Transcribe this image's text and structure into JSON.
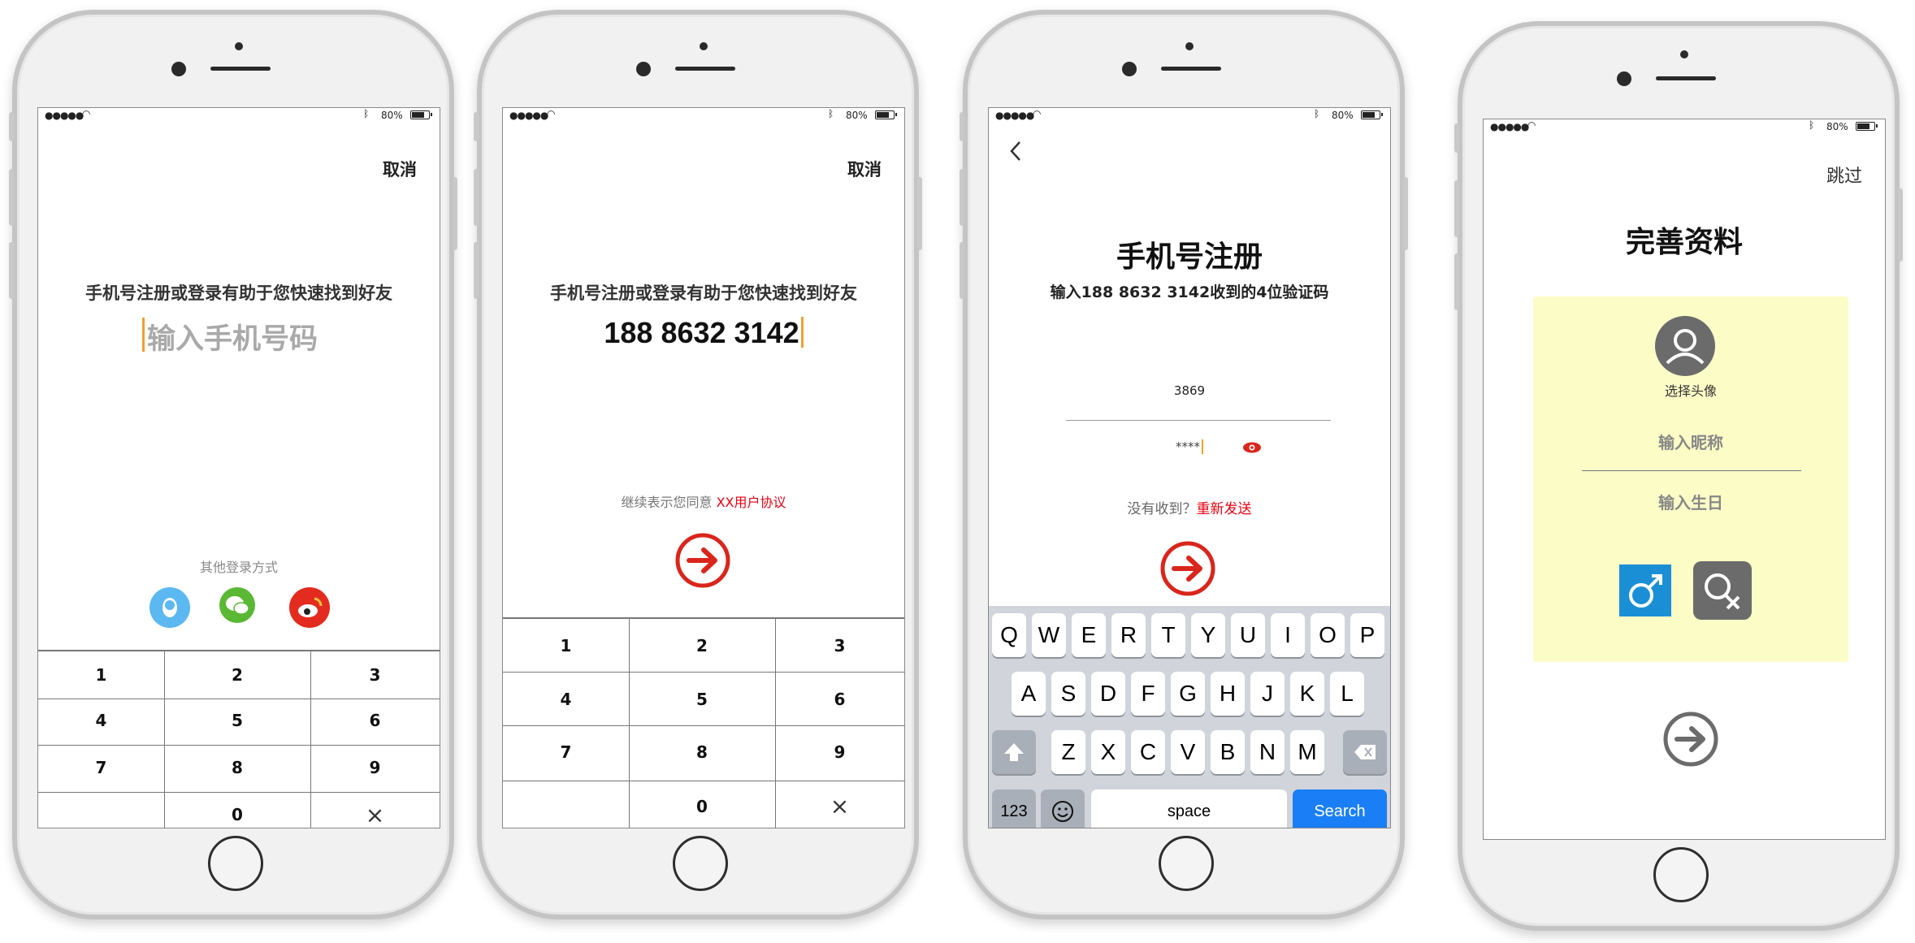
{
  "status": {
    "battery": "80%"
  },
  "screen1": {
    "cancel": "取消",
    "prompt": "手机号注册或登录有助于您快速找到好友",
    "phone_placeholder": "输入手机号码",
    "other_login": "其他登录方式",
    "social_icons": [
      "qq-icon",
      "wechat-icon",
      "weibo-icon"
    ],
    "keys": [
      "1",
      "2",
      "3",
      "4",
      "5",
      "6",
      "7",
      "8",
      "9",
      "",
      "0",
      "×"
    ]
  },
  "screen2": {
    "cancel": "取消",
    "prompt": "手机号注册或登录有助于您快速找到好友",
    "phone_value": "188 8632 3142",
    "agree_text": "继续表示您同意",
    "agreement_link": "XX用户协议",
    "keys": [
      "1",
      "2",
      "3",
      "4",
      "5",
      "6",
      "7",
      "8",
      "9",
      "",
      "0",
      "×"
    ]
  },
  "screen3": {
    "title": "手机号注册",
    "subtitle": "输入188 8632 3142收到的4位验证码",
    "code_value": "3869",
    "code_masked": "****",
    "not_received": "没有收到？",
    "resend": "重新发送",
    "keyboard": {
      "row1": [
        "Q",
        "W",
        "E",
        "R",
        "T",
        "Y",
        "U",
        "I",
        "O",
        "P"
      ],
      "row2": [
        "A",
        "S",
        "D",
        "F",
        "G",
        "H",
        "J",
        "K",
        "L"
      ],
      "row3": [
        "Z",
        "X",
        "C",
        "V",
        "B",
        "N",
        "M"
      ],
      "numbers_key": "123",
      "space_key": "space",
      "search_key": "Search"
    }
  },
  "screen4": {
    "skip": "跳过",
    "title": "完善资料",
    "choose_avatar": "选择头像",
    "nickname_placeholder": "输入昵称",
    "birthday_placeholder": "输入生日"
  },
  "colors": {
    "accent_red": "#d9261c",
    "link_red": "#e60012",
    "cursor_orange": "#f0a030",
    "qq_blue": "#5cb8f0",
    "wechat_green": "#5ab835",
    "weibo_red": "#e32c1f",
    "profile_card": "#fbfcc6",
    "male_blue": "#1b8fd6",
    "female_gray": "#6b6b6b",
    "search_blue": "#1a7ff6",
    "keyboard_bg": "#d1d5db"
  }
}
